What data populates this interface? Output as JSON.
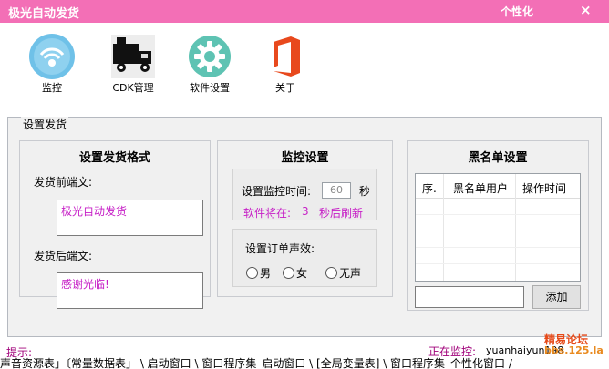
{
  "window": {
    "title": "极光自动发货",
    "personalize_label": "个性化",
    "close_glyph": "×",
    "title_bar_color": "#f36fb6"
  },
  "toolbar": {
    "items": [
      {
        "label": "监控",
        "icon": "wifi-signal-icon"
      },
      {
        "label": "CDK管理",
        "icon": "delivery-truck-icon"
      },
      {
        "label": "软件设置",
        "icon": "gear-icon"
      },
      {
        "label": "关于",
        "icon": "office-logo-icon"
      }
    ]
  },
  "shipping_group": {
    "legend": "设置发货",
    "format_panel": {
      "title": "设置发货格式",
      "prefix_label": "发货前端文:",
      "prefix_value": "极光自动发货",
      "suffix_label": "发货后端文:",
      "suffix_value": "感谢光临!"
    },
    "monitor_panel": {
      "title": "监控设置",
      "interval_label": "设置监控时间:",
      "interval_value": "60",
      "interval_unit": "秒",
      "refresh_prefix": "软件将在:",
      "refresh_count": "3",
      "refresh_suffix": "秒后刷新",
      "sound_label": "设置订单声效:",
      "sound_options": [
        "男",
        "女",
        "无声"
      ]
    },
    "blacklist_panel": {
      "title": "黑名单设置",
      "columns": [
        "序.",
        "黑名单用户",
        "操作时间"
      ],
      "add_button": "添加"
    }
  },
  "status": {
    "tip_label": "提示:",
    "monitoring_label": "正在监控:",
    "monitoring_user": "yuanhaiyun198"
  },
  "bottom_strip": "声音资源表」〔常量数据表」 \\ 启动窗口 \\ 窗口程序集_启动窗口 \\ [全局变量表] \\ 窗口程序集_个性化窗口 /",
  "watermark": {
    "line1": "精易论坛",
    "line2": "bbs.125.la"
  },
  "colors": {
    "accent": "#f36fb6",
    "text_magenta": "#c61fc6"
  }
}
